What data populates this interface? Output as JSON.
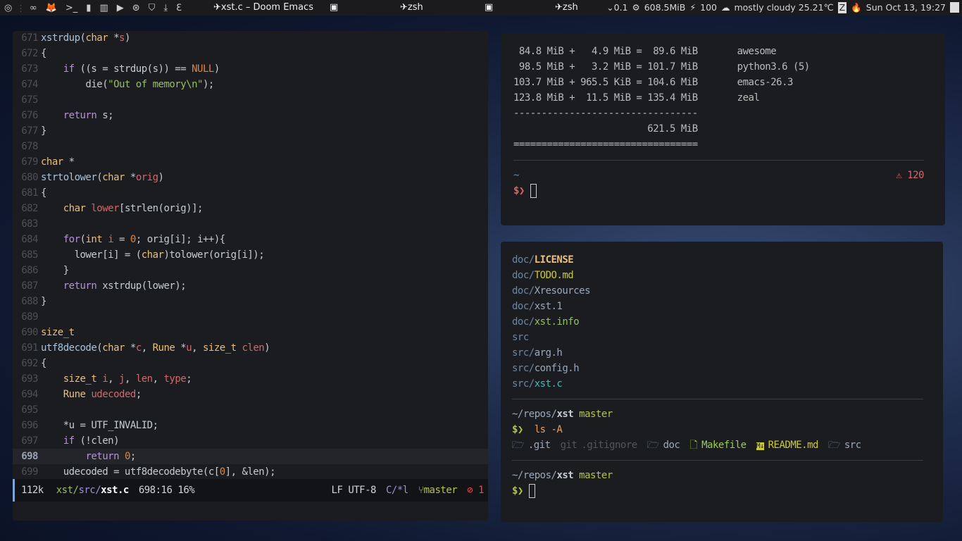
{
  "topbar": {
    "launcher_icons": [
      "awesome-icon",
      "infinity-icon",
      "firefox-icon",
      "terminal-icon",
      "android-icon",
      "book-icon",
      "play-icon",
      "gamepad-icon",
      "shield-icon",
      "download-icon",
      "emacs-icon"
    ],
    "tasks": [
      {
        "icon": "plane-icon",
        "label": "✈xst.c – Doom Emacs"
      },
      {
        "icon": "terminal-app-icon",
        "label": ""
      },
      {
        "icon": "plane-icon",
        "label": "✈zsh"
      },
      {
        "icon": "terminal-app-icon",
        "label": ""
      },
      {
        "icon": "plane-icon",
        "label": "✈zsh"
      }
    ],
    "tray": {
      "load": "⌄0.1",
      "memory": "608.5MiB",
      "battery": "100",
      "weather": "mostly cloudy 25.21℃",
      "clock": "Sun Oct 13, 19:27"
    }
  },
  "editor": {
    "lines": [
      {
        "n": "671",
        "t": [
          [
            "xstrdup",
            "f"
          ],
          [
            "(",
            "p"
          ],
          [
            "char",
            "t"
          ],
          [
            " *",
            "p"
          ],
          [
            "s",
            "v"
          ],
          [
            ")",
            "p"
          ]
        ]
      },
      {
        "n": "672",
        "t": [
          [
            "{",
            "p"
          ]
        ]
      },
      {
        "n": "673",
        "t": [
          [
            "    ",
            "p"
          ],
          [
            "if",
            "k"
          ],
          [
            " ((s = strdup(s)) == ",
            "p"
          ],
          [
            "NULL",
            "c"
          ],
          [
            ")",
            "p"
          ]
        ]
      },
      {
        "n": "674",
        "t": [
          [
            "        die(",
            "p"
          ],
          [
            "\"Out of memory\\n\"",
            "s"
          ],
          [
            ");",
            "p"
          ]
        ]
      },
      {
        "n": "675",
        "t": []
      },
      {
        "n": "676",
        "t": [
          [
            "    ",
            "p"
          ],
          [
            "return",
            "k"
          ],
          [
            " s;",
            "p"
          ]
        ]
      },
      {
        "n": "677",
        "t": [
          [
            "}",
            "p"
          ]
        ]
      },
      {
        "n": "678",
        "t": []
      },
      {
        "n": "679",
        "t": [
          [
            "char",
            "t"
          ],
          [
            " *",
            "p"
          ]
        ]
      },
      {
        "n": "680",
        "t": [
          [
            "strtolower",
            "f"
          ],
          [
            "(",
            "p"
          ],
          [
            "char",
            "t"
          ],
          [
            " *",
            "p"
          ],
          [
            "orig",
            "v"
          ],
          [
            ")",
            "p"
          ]
        ]
      },
      {
        "n": "681",
        "t": [
          [
            "{",
            "p"
          ]
        ]
      },
      {
        "n": "682",
        "t": [
          [
            "    ",
            "p"
          ],
          [
            "char",
            "t"
          ],
          [
            " ",
            "p"
          ],
          [
            "lower",
            "v"
          ],
          [
            "[strlen(orig)];",
            "p"
          ]
        ]
      },
      {
        "n": "683",
        "t": []
      },
      {
        "n": "684",
        "t": [
          [
            "    ",
            "p"
          ],
          [
            "for",
            "k"
          ],
          [
            "(",
            "p"
          ],
          [
            "int",
            "t"
          ],
          [
            " ",
            "p"
          ],
          [
            "i",
            "v"
          ],
          [
            " = ",
            "p"
          ],
          [
            "0",
            "c"
          ],
          [
            "; orig[i]; i++){",
            "p"
          ]
        ]
      },
      {
        "n": "685",
        "t": [
          [
            "      lower[i] = (",
            "p"
          ],
          [
            "char",
            "t"
          ],
          [
            ")tolower(orig[i]);",
            "p"
          ]
        ]
      },
      {
        "n": "686",
        "t": [
          [
            "    }",
            "p"
          ]
        ]
      },
      {
        "n": "687",
        "t": [
          [
            "    ",
            "p"
          ],
          [
            "return",
            "k"
          ],
          [
            " xstrdup(lower);",
            "p"
          ]
        ]
      },
      {
        "n": "688",
        "t": [
          [
            "}",
            "p"
          ]
        ]
      },
      {
        "n": "689",
        "t": []
      },
      {
        "n": "690",
        "t": [
          [
            "size_t",
            "t"
          ]
        ]
      },
      {
        "n": "691",
        "t": [
          [
            "utf8decode",
            "f"
          ],
          [
            "(",
            "p"
          ],
          [
            "char",
            "t"
          ],
          [
            " *",
            "p"
          ],
          [
            "c",
            "v"
          ],
          [
            ", ",
            "p"
          ],
          [
            "Rune",
            "t"
          ],
          [
            " *",
            "p"
          ],
          [
            "u",
            "v"
          ],
          [
            ", ",
            "p"
          ],
          [
            "size_t",
            "t"
          ],
          [
            " ",
            "p"
          ],
          [
            "clen",
            "v"
          ],
          [
            ")",
            "p"
          ]
        ]
      },
      {
        "n": "692",
        "t": [
          [
            "{",
            "p"
          ]
        ]
      },
      {
        "n": "693",
        "t": [
          [
            "    ",
            "p"
          ],
          [
            "size_t",
            "t"
          ],
          [
            " ",
            "p"
          ],
          [
            "i",
            "v"
          ],
          [
            ", ",
            "p"
          ],
          [
            "j",
            "v"
          ],
          [
            ", ",
            "p"
          ],
          [
            "len",
            "v"
          ],
          [
            ", ",
            "p"
          ],
          [
            "type",
            "v"
          ],
          [
            ";",
            "p"
          ]
        ]
      },
      {
        "n": "694",
        "t": [
          [
            "    ",
            "p"
          ],
          [
            "Rune",
            "t"
          ],
          [
            " ",
            "p"
          ],
          [
            "udecoded",
            "v"
          ],
          [
            ";",
            "p"
          ]
        ]
      },
      {
        "n": "695",
        "t": []
      },
      {
        "n": "696",
        "t": [
          [
            "    *u = UTF_INVALID;",
            "p"
          ]
        ]
      },
      {
        "n": "697",
        "t": [
          [
            "    ",
            "p"
          ],
          [
            "if",
            "k"
          ],
          [
            " (!clen)",
            "p"
          ]
        ]
      },
      {
        "n": "698",
        "t": [
          [
            "        ",
            "p"
          ],
          [
            "return",
            "k"
          ],
          [
            " ",
            "p"
          ],
          [
            "0",
            "c"
          ],
          [
            ";",
            "p"
          ]
        ],
        "current": true
      },
      {
        "n": "699",
        "t": [
          [
            "    udecoded = utf8decodebyte(c[",
            "p"
          ],
          [
            "0",
            "c"
          ],
          [
            "], &len);",
            "p"
          ]
        ]
      }
    ],
    "modeline": {
      "size": "112k",
      "path_dir1": "xst/",
      "path_dir2": "src/",
      "file": "xst.c",
      "position": "698:16",
      "percent": "16%",
      "eol": "LF",
      "encoding": "UTF-8",
      "mode": "C/*l",
      "branch": "master",
      "errors": "1"
    }
  },
  "term1": {
    "rows": [
      {
        "mem": " 84.8 MiB +   4.9 MiB =  89.6 MiB",
        "proc": "awesome"
      },
      {
        "mem": " 98.5 MiB +   3.2 MiB = 101.7 MiB",
        "proc": "python3.6 (5)"
      },
      {
        "mem": "103.7 MiB + 965.5 KiB = 104.6 MiB",
        "proc": "emacs-26.3"
      },
      {
        "mem": "123.8 MiB +  11.5 MiB = 135.4 MiB",
        "proc": "zeal"
      }
    ],
    "dashes": "---------------------------------",
    "total": "                        621.5 MiB",
    "equals": "=================================",
    "cwd": "~",
    "exit_status": "120",
    "prompt": "$❯"
  },
  "term2": {
    "files": [
      [
        "doc/",
        "LICENSE",
        "#ecbe7b"
      ],
      [
        "doc/",
        "TODO.md",
        "#c9c93a"
      ],
      [
        "doc/",
        "Xresources",
        "#9aa8bb"
      ],
      [
        "doc/",
        "xst.1",
        "#9aa8bb"
      ],
      [
        "doc/",
        "xst.info",
        "#98be65"
      ],
      [
        "src",
        "",
        "#9aa8bb"
      ],
      [
        "src/",
        "arg.h",
        "#9aa8bb"
      ],
      [
        "src/",
        "config.h",
        "#9aa8bb"
      ],
      [
        "src/",
        "xst.c",
        "#4db5bd"
      ]
    ],
    "cwd_prefix": "~/repos/",
    "cwd_dir": "xst",
    "branch": "master",
    "prompt": "$❯",
    "command": "ls -A",
    "ls": [
      {
        "icon": "folder-icon",
        "name": ".git",
        "color": "#9aa8bb"
      },
      {
        "icon": "git-icon",
        "name": ".gitignore",
        "color": "#555"
      },
      {
        "icon": "folder-icon",
        "name": "doc",
        "color": "#9aa8bb"
      },
      {
        "icon": "file-icon",
        "name": "Makefile",
        "color": "#98d048"
      },
      {
        "icon": "markdown-icon",
        "name": "README.md",
        "color": "#c9c93a"
      },
      {
        "icon": "folder-icon",
        "name": "src",
        "color": "#9aa8bb"
      }
    ],
    "folder_color": "#6b86a8"
  }
}
